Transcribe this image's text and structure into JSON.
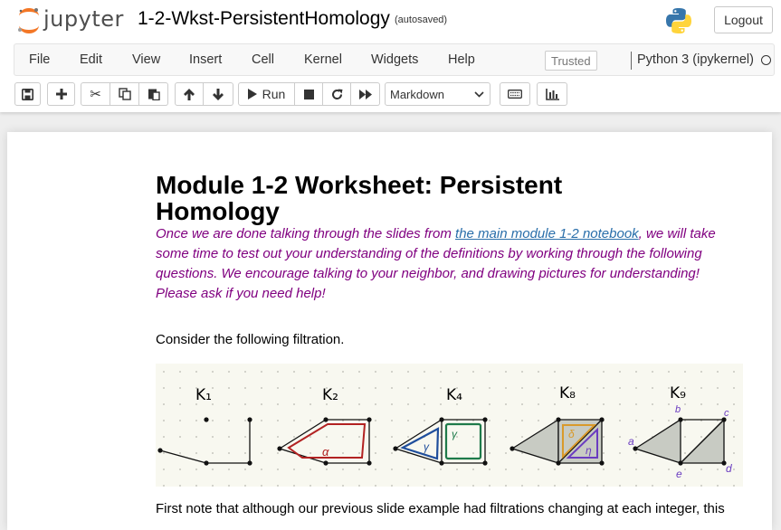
{
  "header": {
    "logo_text": "jupyter",
    "notebook_title": "1-2-Wkst-PersistentHomology",
    "autosave_status": "(autosaved)",
    "logout_label": "Logout"
  },
  "menubar": {
    "items": [
      "File",
      "Edit",
      "View",
      "Insert",
      "Cell",
      "Kernel",
      "Widgets",
      "Help"
    ],
    "trusted_label": "Trusted",
    "kernel_name": "Python 3 (ipykernel)"
  },
  "toolbar": {
    "run_label": "Run",
    "cell_type": "Markdown"
  },
  "content": {
    "heading": "Module 1-2 Worksheet: Persistent Homology",
    "intro_before_link": "Once we are done talking through the slides from ",
    "intro_link": "the main module 1-2 notebook",
    "intro_after_link": ", we will take some time to test out your understanding of the definitions by working through the following questions. We encourage talking to your neighbor, and drawing pictures for understanding! Please ask if you need help!",
    "filtration_text": "Consider the following filtration.",
    "next_paragraph": "First note that although our previous slide example had filtrations changing at each integer, this"
  },
  "figure": {
    "stage_labels": [
      "K₁",
      "K₂",
      "K₄",
      "K₈",
      "K₉"
    ],
    "vertex_labels": [
      "a",
      "b",
      "c",
      "d",
      "e"
    ],
    "region_labels": [
      "α",
      "γ",
      "γ",
      "δ",
      "η"
    ]
  },
  "colors": {
    "purple_text": "#800080",
    "link": "#296eaa",
    "filled_triangle": "#c8cbc3",
    "red_loop": "#b22222",
    "blue_loop": "#1f4e9c",
    "green_loop": "#1e7a4a",
    "orange_loop": "#d99a2b",
    "purple_loop": "#6a3cc0"
  }
}
